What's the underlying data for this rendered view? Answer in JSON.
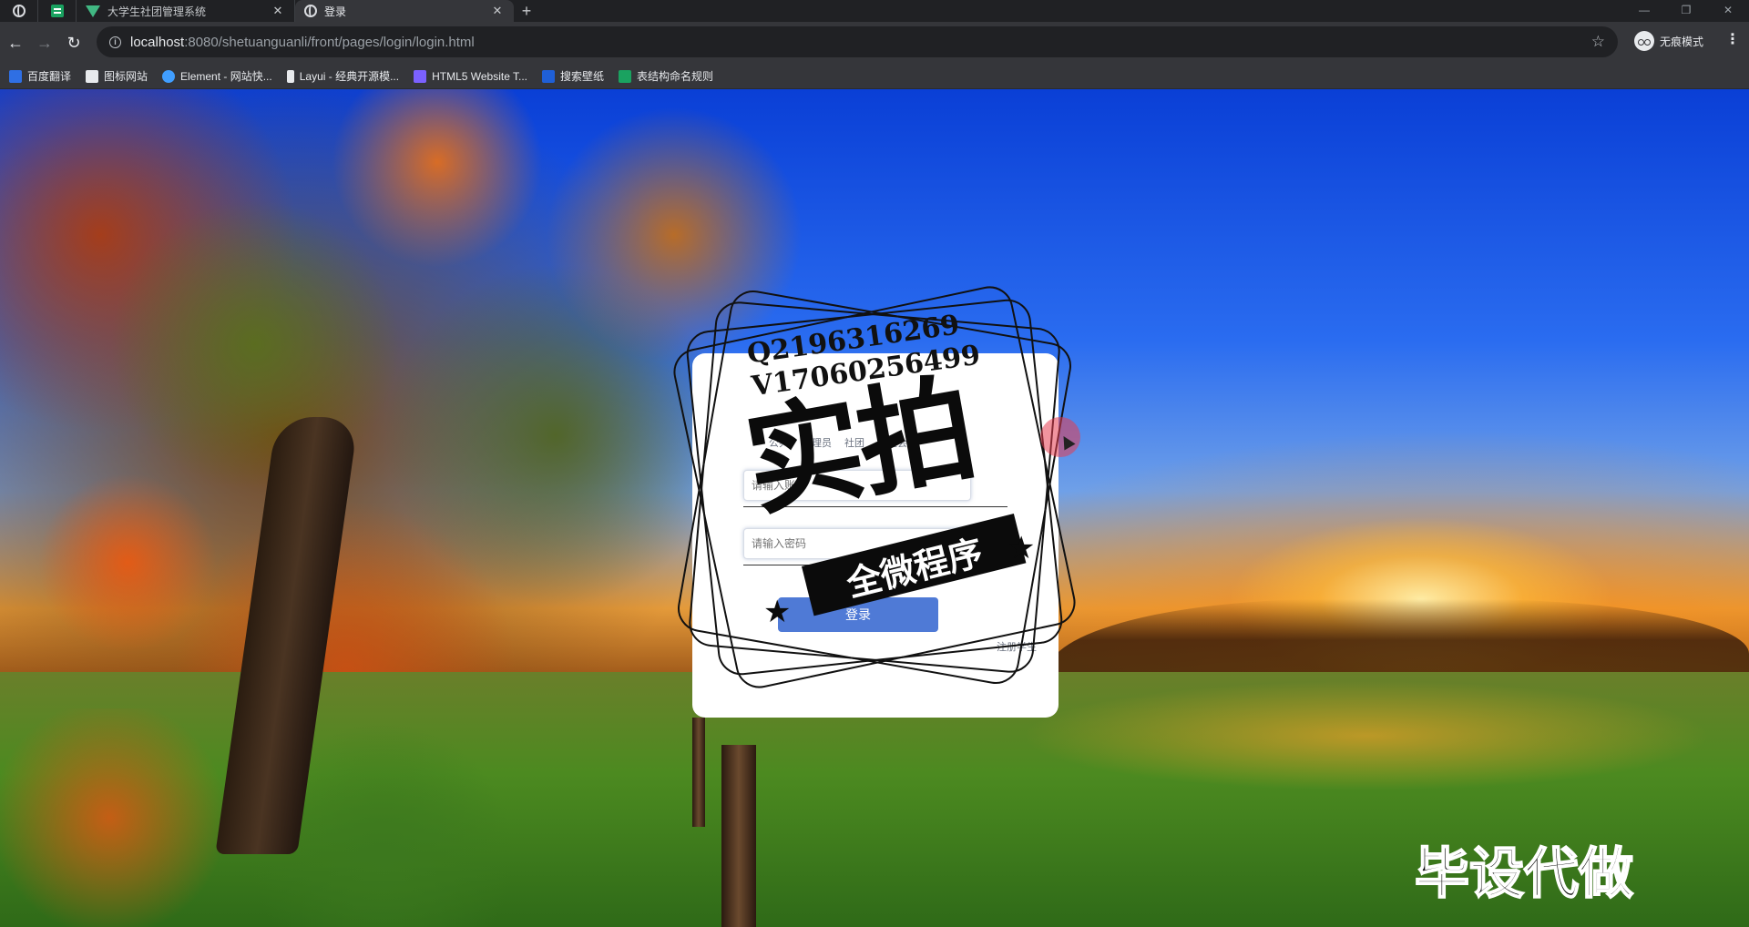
{
  "browser": {
    "tabs": [
      {
        "title": "",
        "icon": "globe-icon"
      },
      {
        "title": "",
        "icon": "green-sheet-icon"
      },
      {
        "title": "大学生社团管理系统",
        "icon": "vue-icon"
      },
      {
        "title": "登录",
        "icon": "globe-icon",
        "active": true
      }
    ],
    "new_tab": "+",
    "url_host": "localhost",
    "url_rest": ":8080/shetuanguanli/front/pages/login/login.html",
    "incognito_label": "无痕模式",
    "bookmarks": [
      {
        "label": "百度翻译",
        "color": "#2f6fe4"
      },
      {
        "label": "图标网站",
        "color": "#e8eaed"
      },
      {
        "label": "Element - 网站快...",
        "color": "#409eff"
      },
      {
        "label": "Layui - 经典开源模...",
        "color": "#e8eaed"
      },
      {
        "label": "HTML5 Website T...",
        "color": "#7b61ff"
      },
      {
        "label": "搜索壁纸",
        "color": "#1f5fd6"
      },
      {
        "label": "表结构命名规则",
        "color": "#1aa260"
      }
    ]
  },
  "login": {
    "roles": [
      "公共",
      "管理员",
      "社团",
      "学生会"
    ],
    "username_placeholder": "请输入账号",
    "password_placeholder": "请输入密码",
    "login_button": "登录",
    "register_link": "注册学生"
  },
  "watermark": {
    "contact_q": "Q2196316269",
    "contact_v": "V17060256499",
    "big_text": "实拍",
    "banner_text": "全微程序",
    "corner_text": "毕设代做"
  }
}
